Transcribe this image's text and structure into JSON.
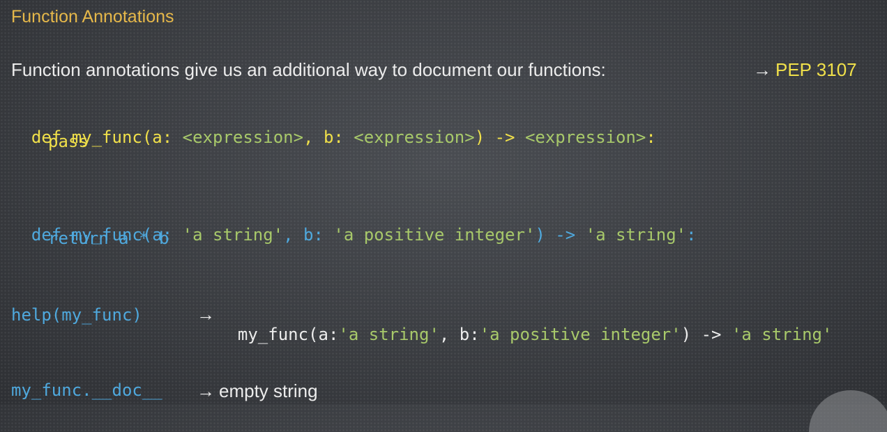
{
  "title": "Function Annotations",
  "intro": {
    "text": "Function annotations give us an additional way to document our functions:",
    "arrow": "→",
    "pep": "PEP 3107"
  },
  "code1": {
    "line1": {
      "def_sig": "def my_func(a: ",
      "expr1": "<expression>",
      "comma_b": ", b: ",
      "expr2": "<expression>",
      "arrow": ") -> ",
      "expr3": "<expression>",
      "colon": ":"
    },
    "line2": "pass"
  },
  "code2": {
    "line1": {
      "def_sig": "def my_func(a: ",
      "s1": "'a string'",
      "comma_b": ", b: ",
      "s2": "'a positive integer'",
      "arrow": ") -> ",
      "s3": "'a string'",
      "colon": ":"
    },
    "line2": "return a * b"
  },
  "help": {
    "call": "help(my_func)",
    "arrow": "→",
    "sig_start": "my_func(a:",
    "s1": "'a string'",
    "comma_b": ", b:",
    "s2": "'a positive integer'",
    "ret": ") -> ",
    "s3": "'a string'"
  },
  "doc": {
    "expr": "my_func.__doc__",
    "arrow": "→",
    "result": "empty string"
  }
}
